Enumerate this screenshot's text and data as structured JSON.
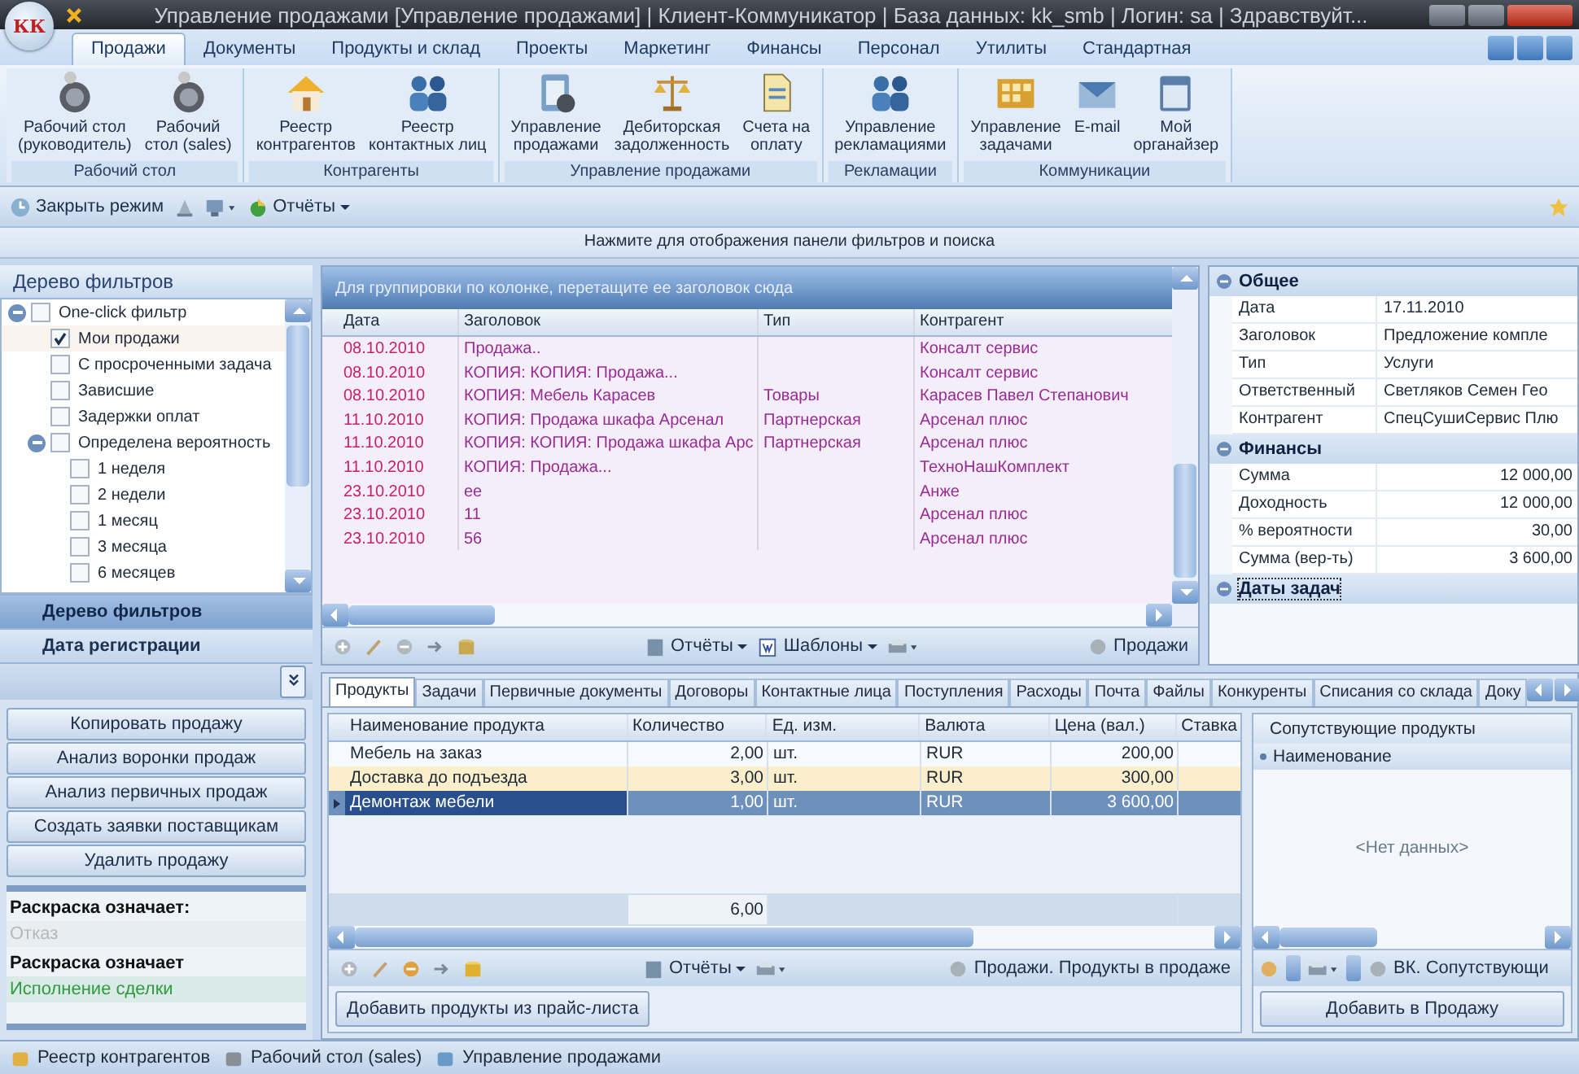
{
  "window": {
    "logo": "КК",
    "title": "Управление продажами [Управление продажами] | Клиент-Коммуникатор | База данных: kk_smb | Логин: sa | Здравствуйт..."
  },
  "ribbon": {
    "tabs": [
      {
        "label": "Продажи",
        "selected": true
      },
      {
        "label": "Документы",
        "selected": false
      },
      {
        "label": "Продукты и склад",
        "selected": false
      },
      {
        "label": "Проекты",
        "selected": false
      },
      {
        "label": "Маркетинг",
        "selected": false
      },
      {
        "label": "Финансы",
        "selected": false
      },
      {
        "label": "Персонал",
        "selected": false
      },
      {
        "label": "Утилиты",
        "selected": false
      },
      {
        "label": "Стандартная",
        "selected": false
      }
    ],
    "groups": [
      {
        "title": "Рабочий стол",
        "buttons": [
          {
            "lines": [
              "Рабочий стол",
              "(руководитель)"
            ]
          },
          {
            "lines": [
              "Рабочий",
              "стол (sales)"
            ]
          }
        ]
      },
      {
        "title": "Контрагенты",
        "buttons": [
          {
            "lines": [
              "Реестр",
              "контрагентов"
            ]
          },
          {
            "lines": [
              "Реестр",
              "контактных лиц"
            ]
          }
        ]
      },
      {
        "title": "Управление продажами",
        "buttons": [
          {
            "lines": [
              "Управление",
              "продажами"
            ]
          },
          {
            "lines": [
              "Дебиторская",
              "задолженность"
            ]
          },
          {
            "lines": [
              "Счета на",
              "оплату"
            ]
          }
        ]
      },
      {
        "title": "Рекламации",
        "buttons": [
          {
            "lines": [
              "Управление",
              "рекламациями"
            ]
          }
        ]
      },
      {
        "title": "Коммуникации",
        "buttons": [
          {
            "lines": [
              "Управление",
              "задачами"
            ]
          },
          {
            "lines": [
              "E-mail"
            ]
          },
          {
            "lines": [
              "Мой",
              "органайзер"
            ]
          }
        ]
      }
    ]
  },
  "quick_toolbar": {
    "close_mode": "Закрыть режим",
    "reports": "Отчёты"
  },
  "filter_bar": "Нажмите для отображения панели фильтров и поиска",
  "filter_tree": {
    "title": "Дерево фильтров",
    "items": [
      {
        "label": "One-click фильтр",
        "checked": false,
        "selected": false,
        "expanded": true,
        "children": [
          {
            "label": "Мои продажи",
            "checked": true,
            "selected": true
          },
          {
            "label": "С просроченными задача",
            "checked": false,
            "selected": false
          },
          {
            "label": "Зависшие",
            "checked": false,
            "selected": false
          },
          {
            "label": "Задержки оплат",
            "checked": false,
            "selected": false
          },
          {
            "label": "Определена вероятность",
            "checked": false,
            "selected": false,
            "expanded": true,
            "children": [
              {
                "label": "1 неделя",
                "checked": false,
                "selected": false
              },
              {
                "label": "2 недели",
                "checked": false,
                "selected": false
              },
              {
                "label": "1 месяц",
                "checked": false,
                "selected": false
              },
              {
                "label": "3 месяца",
                "checked": false,
                "selected": false
              },
              {
                "label": "6 месяцев",
                "checked": false,
                "selected": false
              }
            ]
          }
        ]
      }
    ]
  },
  "nav": [
    {
      "label": "Дерево фильтров",
      "selected": true
    },
    {
      "label": "Дата регистрации",
      "selected": false
    }
  ],
  "actions": [
    "Копировать продажу",
    "Анализ воронки продаж",
    "Анализ первичных продаж",
    "Создать заявки поставщикам",
    "Удалить продажу"
  ],
  "legend": [
    {
      "kind": "heading",
      "text": "Раскраска означает:"
    },
    {
      "kind": "swatch",
      "text": "Отказ",
      "color": "#b8b8b8"
    },
    {
      "kind": "heading",
      "text": "Раскраска означает"
    },
    {
      "kind": "swatch",
      "text": "Исполнение сделки",
      "color": "#2f9a40"
    }
  ],
  "sales_grid": {
    "group_hint": "Для группировки по колонке, перетащите ее заголовок сюда",
    "columns": [
      "Дата",
      "Заголовок",
      "Тип",
      "Контрагент"
    ],
    "rows": [
      {
        "date": "08.10.2010",
        "title": "Продажа..",
        "counterparty": "Консалт сервис"
      },
      {
        "date": "08.10.2010",
        "title": "КОПИЯ: КОПИЯ: Продажа...",
        "counterparty": "Консалт сервис"
      },
      {
        "date": "08.10.2010",
        "title": "КОПИЯ: Мебель Карасев",
        "type": "Товары",
        "counterparty": "Карасев Павел Степанович"
      },
      {
        "date": "11.10.2010",
        "title": "КОПИЯ: Продажа шкафа Арсенал",
        "type": "Партнерская",
        "counterparty": "Арсенал плюс"
      },
      {
        "date": "11.10.2010",
        "title": "КОПИЯ: КОПИЯ: Продажа шкафа Арс",
        "type": "Партнерская",
        "counterparty": "Арсенал плюс"
      },
      {
        "date": "11.10.2010",
        "title": "КОПИЯ: Продажа...",
        "counterparty": "ТехноНашКомплект"
      },
      {
        "date": "23.10.2010",
        "title": "ee",
        "counterparty": "Анже"
      },
      {
        "date": "23.10.2010",
        "title": "11",
        "counterparty": "Арсенал плюс"
      },
      {
        "date": "23.10.2010",
        "title": "56",
        "counterparty": "Арсенал плюс"
      }
    ],
    "toolbar": {
      "reports": "Отчёты",
      "templates": "Шаблоны",
      "source": "Продажи"
    }
  },
  "properties": {
    "categories": [
      {
        "title": "Общее",
        "kind": "text",
        "selected": false,
        "rows": [
          {
            "name": "Дата",
            "value": "17.11.2010"
          },
          {
            "name": "Заголовок",
            "value": "Предложение компле"
          },
          {
            "name": "Тип",
            "value": "Услуги"
          },
          {
            "name": "Ответственный",
            "value": "Светляков Семен Гео"
          },
          {
            "name": "Контрагент",
            "value": "СпецСушиСервис Плю"
          }
        ]
      },
      {
        "title": "Финансы",
        "kind": "money",
        "selected": false,
        "rows": [
          {
            "name": "Сумма",
            "value": "12 000,00"
          },
          {
            "name": "Доходность",
            "value": "12 000,00"
          },
          {
            "name": "% вероятности",
            "value": "30,00"
          },
          {
            "name": "Сумма (вер-ть)",
            "value": "3 600,00"
          }
        ]
      },
      {
        "title": "Даты задач",
        "selected": true
      }
    ]
  },
  "detail_tabs": [
    {
      "label": "Продукты",
      "selected": true
    },
    {
      "label": "Задачи",
      "selected": false
    },
    {
      "label": "Первичные документы",
      "selected": false
    },
    {
      "label": "Договоры",
      "selected": false
    },
    {
      "label": "Контактные лица",
      "selected": false
    },
    {
      "label": "Поступления",
      "selected": false
    },
    {
      "label": "Расходы",
      "selected": false
    },
    {
      "label": "Почта",
      "selected": false
    },
    {
      "label": "Файлы",
      "selected": false
    },
    {
      "label": "Конкуренты",
      "selected": false
    },
    {
      "label": "Списания со склада",
      "selected": false
    },
    {
      "label": "Доку",
      "selected": false
    }
  ],
  "products": {
    "columns": [
      "Наименование продукта",
      "Количество",
      "Ед. изм.",
      "Валюта",
      "Цена (вал.)",
      "Ставка"
    ],
    "rows": [
      {
        "name": "Мебель на заказ",
        "qty": "2,00",
        "unit": "шт.",
        "currency": "RUR",
        "price": "200,00",
        "selected": false,
        "highlighted": false
      },
      {
        "name": "Доставка до подъезда",
        "qty": "3,00",
        "unit": "шт.",
        "currency": "RUR",
        "price": "300,00",
        "selected": false,
        "highlighted": true
      },
      {
        "name": "Демонтаж мебели",
        "qty": "1,00",
        "unit": "шт.",
        "currency": "RUR",
        "price": "3 600,00",
        "selected": true,
        "highlighted": false
      }
    ],
    "total": "6,00",
    "toolbar": {
      "reports": "Отчёты",
      "source": "Продажи. Продукты в продаже"
    },
    "add_button": "Добавить продукты из прайс-листа"
  },
  "related": {
    "title": "Сопутствующие продукты",
    "column": "Наименование",
    "empty": "<Нет данных>",
    "source": "ВК. Сопутствующи",
    "add_button": "Добавить в Продажу"
  },
  "status_bar": [
    "Реестр контрагентов",
    "Рабочий стол (sales)",
    "Управление продажами"
  ]
}
